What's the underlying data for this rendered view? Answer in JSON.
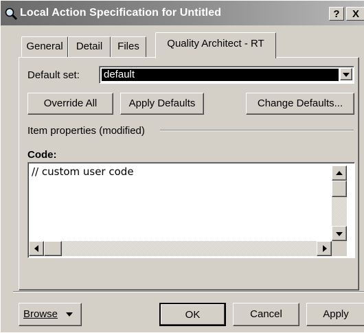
{
  "window": {
    "title": "Local Action Specification for Untitled",
    "help_button": "?",
    "close_button": "X"
  },
  "tabs": [
    {
      "label": "General",
      "active": false
    },
    {
      "label": "Detail",
      "active": false
    },
    {
      "label": "Files",
      "active": false
    },
    {
      "label": "Quality Architect - RT",
      "active": true
    }
  ],
  "default_set": {
    "label": "Default set:",
    "value": "default"
  },
  "buttons": {
    "override_all": "Override All",
    "apply_defaults": "Apply Defaults",
    "change_defaults": "Change Defaults..."
  },
  "item_properties": {
    "label": "Item properties (modified)"
  },
  "code": {
    "label": "Code:",
    "value": "// custom user code"
  },
  "footer": {
    "browse": "Browse",
    "ok": "OK",
    "cancel": "Cancel",
    "apply": "Apply"
  }
}
